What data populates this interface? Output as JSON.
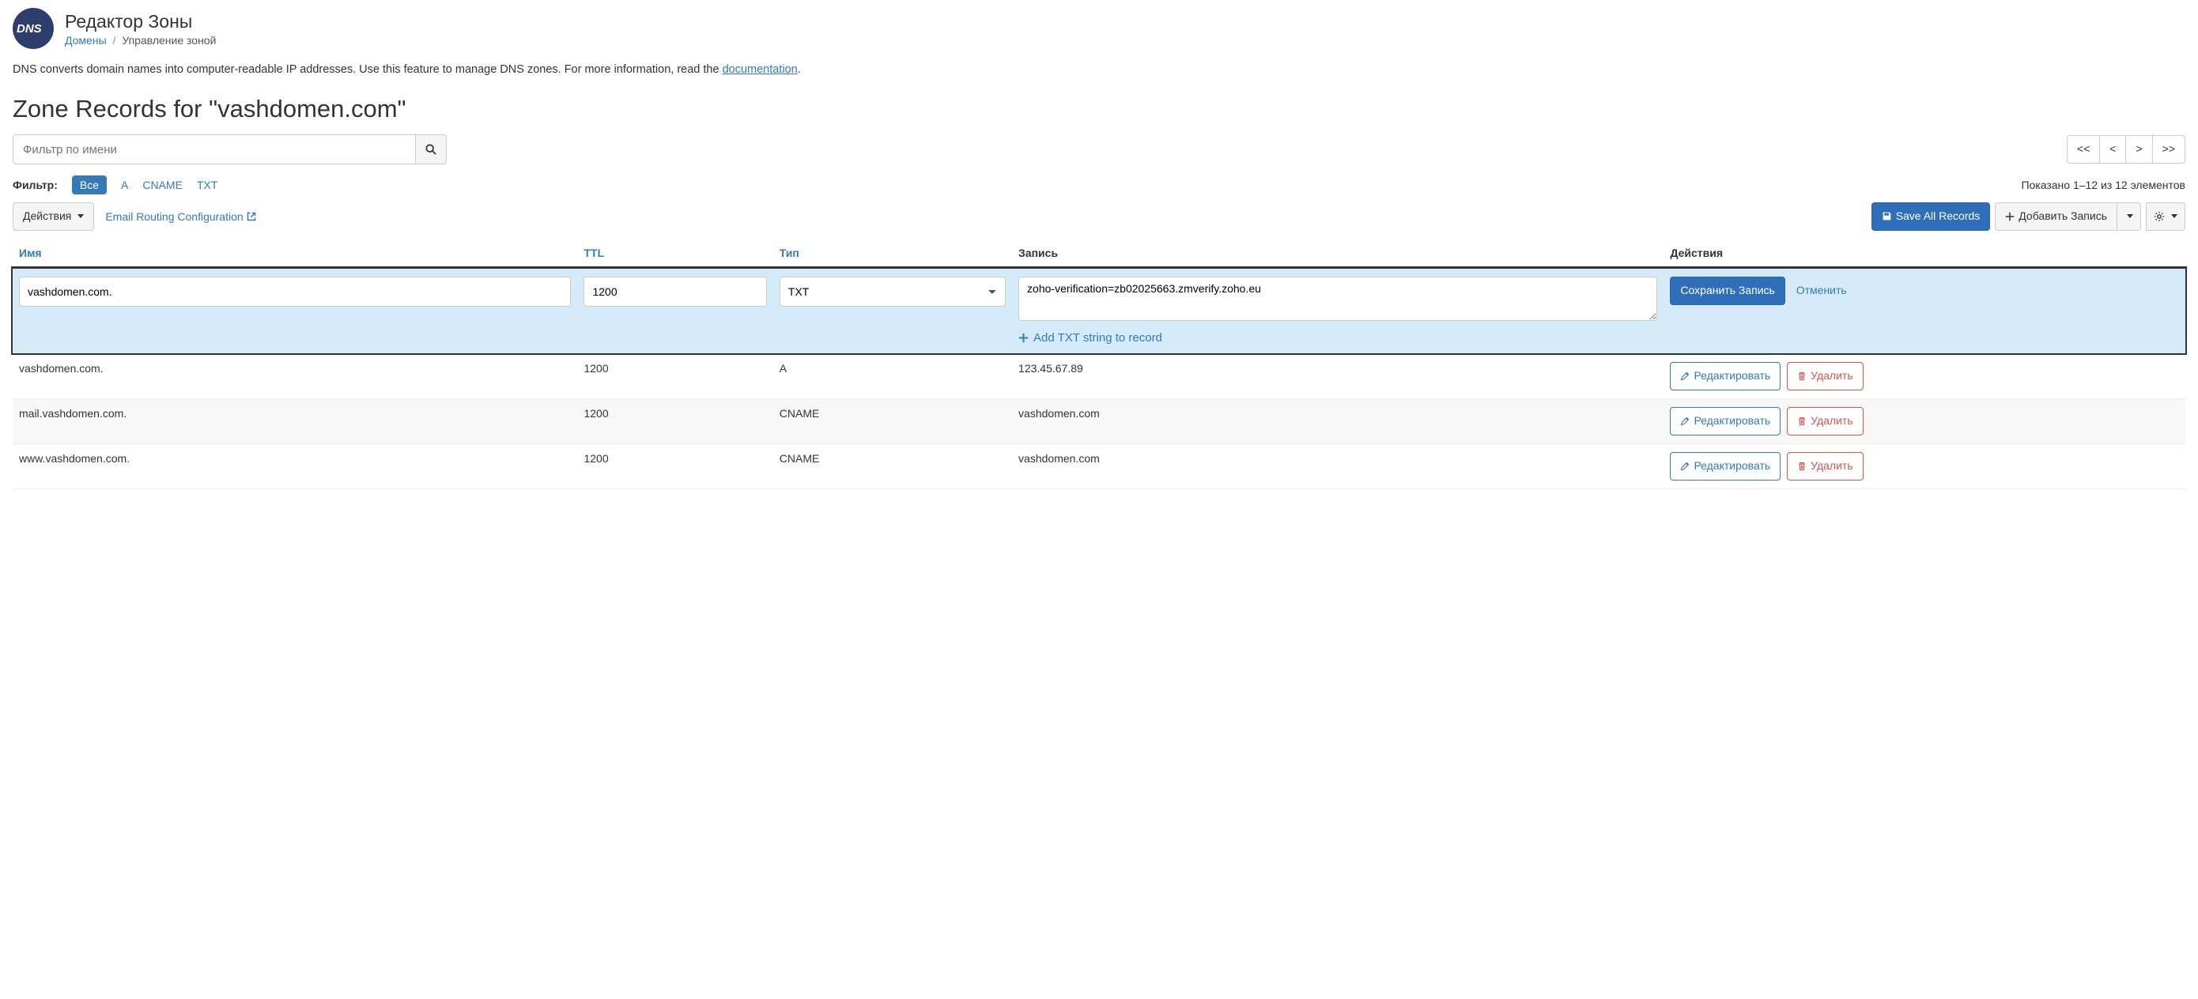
{
  "header": {
    "title": "Редактор Зоны",
    "breadcrumb": {
      "home": "Домены",
      "current": "Управление зоной"
    }
  },
  "intro": {
    "text_before": "DNS converts domain names into computer-readable IP addresses. Use this feature to manage DNS zones. For more information, read the ",
    "link": "documentation",
    "text_after": "."
  },
  "page_title": "Zone Records for \"vashdomen.com\"",
  "filter": {
    "placeholder": "Фильтр по имени",
    "label": "Фильтр:",
    "tabs": {
      "all": "Все",
      "a": "A",
      "cname": "CNAME",
      "txt": "TXT"
    }
  },
  "pager": {
    "first": "<<",
    "prev": "<",
    "next": ">",
    "last": ">>",
    "showing": "Показано 1–12 из 12 элементов"
  },
  "toolbar": {
    "actions": "Действия",
    "email_routing": "Email Routing Configuration",
    "save_all": "Save All Records",
    "add_record": "Добавить Запись"
  },
  "table": {
    "headers": {
      "name": "Имя",
      "ttl": "TTL",
      "type": "Тип",
      "record": "Запись",
      "actions": "Действия"
    },
    "buttons": {
      "save": "Сохранить Запись",
      "cancel": "Отменить",
      "edit": "Редактировать",
      "delete": "Удалить",
      "add_txt": "Add TXT string to record"
    },
    "edit_row": {
      "name": "vashdomen.com.",
      "ttl": "1200",
      "type": "TXT",
      "record": "zoho-verification=zb02025663.zmverify.zoho.eu"
    },
    "rows": [
      {
        "name": "vashdomen.com.",
        "ttl": "1200",
        "type": "A",
        "record": "123.45.67.89"
      },
      {
        "name": "mail.vashdomen.com.",
        "ttl": "1200",
        "type": "CNAME",
        "record": "vashdomen.com"
      },
      {
        "name": "www.vashdomen.com.",
        "ttl": "1200",
        "type": "CNAME",
        "record": "vashdomen.com"
      }
    ]
  }
}
